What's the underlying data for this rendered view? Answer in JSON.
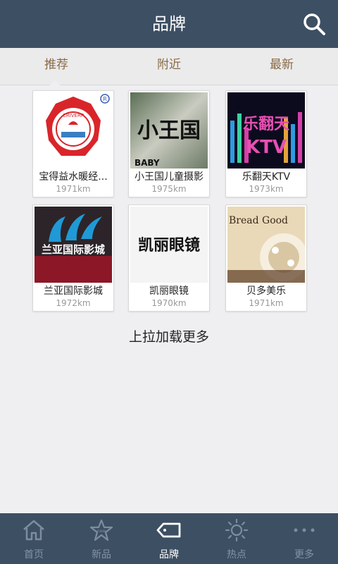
{
  "header": {
    "title": "品牌",
    "search_icon": "search-icon"
  },
  "tabs": [
    {
      "label": "推荐",
      "active": true
    },
    {
      "label": "附近",
      "active": false
    },
    {
      "label": "最新",
      "active": false
    }
  ],
  "brands": [
    {
      "name": "宝得益水暖经...",
      "distance": "1971km",
      "logo_text": "CRIVERP"
    },
    {
      "name": "小王国儿童摄影",
      "distance": "1975km",
      "logo_text": "小王国",
      "logo_sub": "BABY"
    },
    {
      "name": "乐翻天KTV",
      "distance": "1973km",
      "logo_text": "乐翻天",
      "logo_sub": "KTV"
    },
    {
      "name": "兰亚国际影城",
      "distance": "1972km",
      "logo_text": "兰亚国际影城"
    },
    {
      "name": "凯丽眼镜",
      "distance": "1970km",
      "logo_text": "凯丽眼镜"
    },
    {
      "name": "贝多美乐",
      "distance": "1971km",
      "logo_text": "Bread Good"
    }
  ],
  "load_more": "上拉加载更多",
  "bottom_nav": [
    {
      "label": "首页",
      "icon": "home-icon",
      "active": false
    },
    {
      "label": "新品",
      "icon": "new-star-icon",
      "active": false
    },
    {
      "label": "品牌",
      "icon": "tag-icon",
      "active": true
    },
    {
      "label": "热点",
      "icon": "sun-icon",
      "active": false
    },
    {
      "label": "更多",
      "icon": "more-icon",
      "active": false
    }
  ],
  "colors": {
    "header_bg": "#3d4f63",
    "tab_text": "#8a6a45",
    "nav_inactive": "#8393a6"
  }
}
